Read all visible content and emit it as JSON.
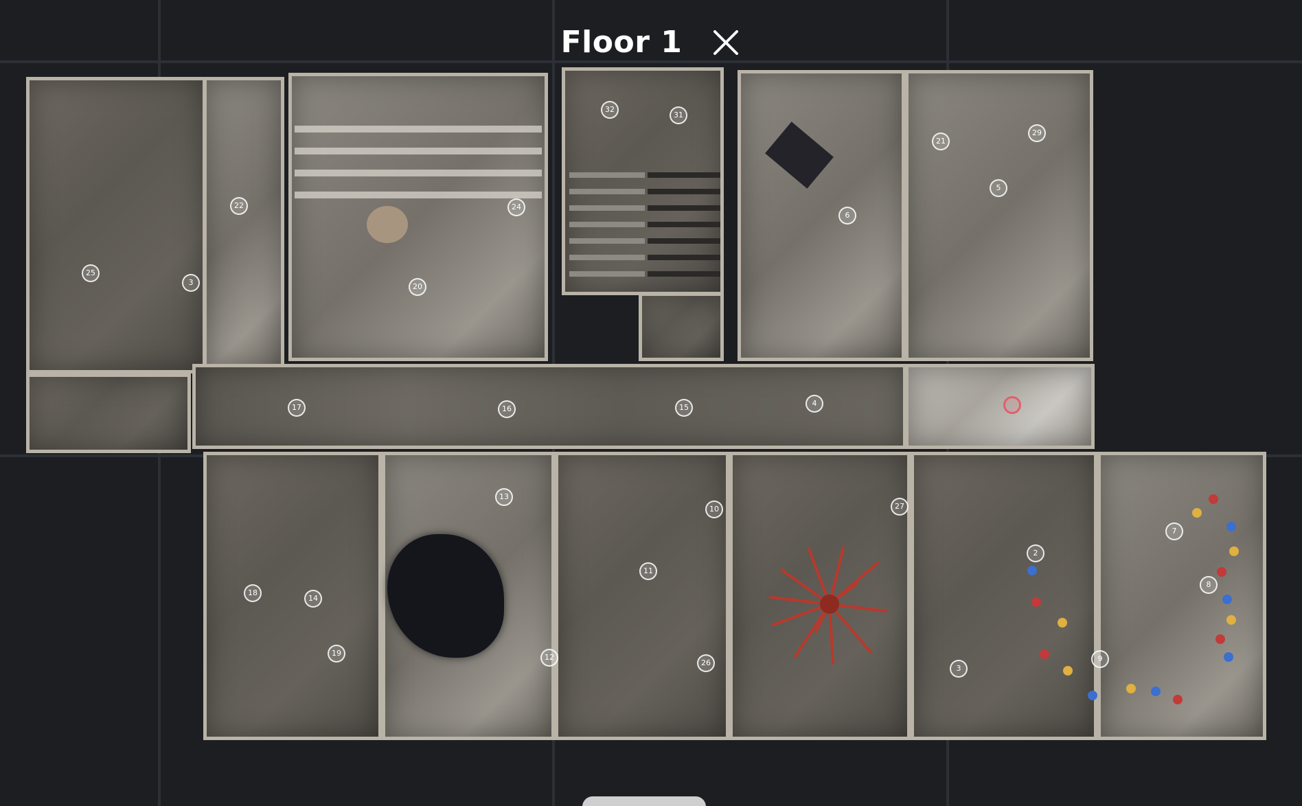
{
  "header": {
    "floor_title": "Floor 1",
    "close_icon": "close-icon"
  },
  "floorplan": {
    "current_position_icon": "current-location-ring",
    "pins": [
      {
        "label": "32"
      },
      {
        "label": "31"
      },
      {
        "label": "29"
      },
      {
        "label": "21"
      },
      {
        "label": "5"
      },
      {
        "label": "6"
      },
      {
        "label": "25"
      },
      {
        "label": "3"
      },
      {
        "label": "20"
      },
      {
        "label": "22"
      },
      {
        "label": "24"
      },
      {
        "label": "17"
      },
      {
        "label": "16"
      },
      {
        "label": "15"
      },
      {
        "label": "4"
      },
      {
        "label": "13"
      },
      {
        "label": "10"
      },
      {
        "label": "27"
      },
      {
        "label": "2"
      },
      {
        "label": "7"
      },
      {
        "label": "11"
      },
      {
        "label": "18"
      },
      {
        "label": "14"
      },
      {
        "label": "8"
      },
      {
        "label": "19"
      },
      {
        "label": "12"
      },
      {
        "label": "26"
      },
      {
        "label": "3"
      },
      {
        "label": "9"
      }
    ]
  },
  "colors": {
    "background": "#1c1e22",
    "grid": "#2c2f35",
    "current_pin": "#e0606a",
    "sculpture_red": "#b8392c"
  }
}
